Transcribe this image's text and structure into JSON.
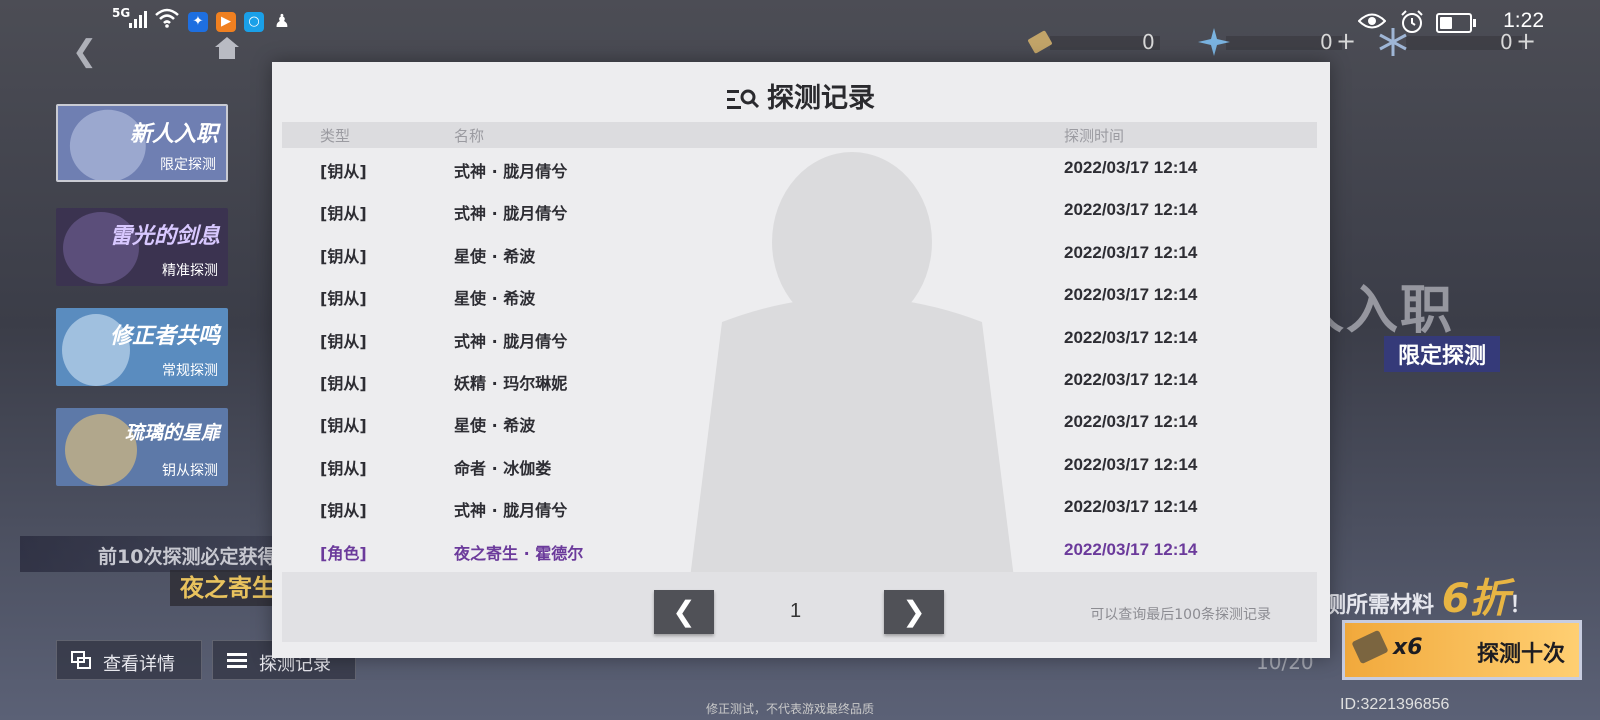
{
  "status_bar": {
    "network": "5G",
    "time": "1:22"
  },
  "currencies": [
    {
      "icon": "ticket-icon",
      "value": "0",
      "has_add": false
    },
    {
      "icon": "crystal-icon",
      "value": "0",
      "has_add": true,
      "add_label": "+"
    },
    {
      "icon": "snowflake-icon",
      "value": "0",
      "has_add": true,
      "add_label": "+"
    }
  ],
  "banners": [
    {
      "title": "新人入职",
      "subtitle": "限定探测",
      "selected": true,
      "color": "#6f7fb2"
    },
    {
      "title": "雷光的剑息",
      "subtitle": "精准探测",
      "selected": false,
      "color": "#3b3350"
    },
    {
      "title": "修正者共鸣",
      "subtitle": "常规探测",
      "selected": false,
      "color": "#5a8cbf"
    },
    {
      "title": "琉璃的星扉",
      "subtitle": "钥从探测",
      "selected": false,
      "color": "#5d79a8"
    }
  ],
  "background": {
    "big_title": "新人入职",
    "limited_tag": "限定探测",
    "guarantee_text": "前10次探测必定获得",
    "guarantee_name": "夜之寄生 · 霍德尔",
    "promo_text": "次探测所需材料",
    "promo_discount": "6折",
    "promo_suffix": "！",
    "progress": "10/20",
    "ten_pull": {
      "count": "x6",
      "label": "探测十次"
    },
    "uid": "ID:3221396856",
    "details_button": "查看详情",
    "record_button": "探测记录",
    "disclaimer": "修正测试，不代表游戏最终品质"
  },
  "dialog": {
    "title": "探测记录",
    "headers": {
      "type": "类型",
      "name": "名称",
      "time": "探测时间"
    },
    "rows": [
      {
        "type": "[钥从]",
        "name": "式神 · 胧月倩兮",
        "time": "2022/03/17 12:14",
        "rarity": "normal"
      },
      {
        "type": "[钥从]",
        "name": "式神 · 胧月倩兮",
        "time": "2022/03/17 12:14",
        "rarity": "normal"
      },
      {
        "type": "[钥从]",
        "name": "星使 · 希波",
        "time": "2022/03/17 12:14",
        "rarity": "normal"
      },
      {
        "type": "[钥从]",
        "name": "星使 · 希波",
        "time": "2022/03/17 12:14",
        "rarity": "normal"
      },
      {
        "type": "[钥从]",
        "name": "式神 · 胧月倩兮",
        "time": "2022/03/17 12:14",
        "rarity": "normal"
      },
      {
        "type": "[钥从]",
        "name": "妖精 · 玛尔琳妮",
        "time": "2022/03/17 12:14",
        "rarity": "normal"
      },
      {
        "type": "[钥从]",
        "name": "星使 · 希波",
        "time": "2022/03/17 12:14",
        "rarity": "normal"
      },
      {
        "type": "[钥从]",
        "name": "命者 · 冰伽娄",
        "time": "2022/03/17 12:14",
        "rarity": "normal"
      },
      {
        "type": "[钥从]",
        "name": "式神 · 胧月倩兮",
        "time": "2022/03/17 12:14",
        "rarity": "normal"
      },
      {
        "type": "[角色]",
        "name": "夜之寄生 · 霍德尔",
        "time": "2022/03/17 12:14",
        "rarity": "character"
      }
    ],
    "pagination": {
      "prev": "❮",
      "page": "1",
      "next": "❯"
    },
    "note": "可以查询最后100条探测记录"
  },
  "colors": {
    "character_row": "#6b3a9b",
    "dialog_bg": "#ededef",
    "page_button": "#505157"
  }
}
